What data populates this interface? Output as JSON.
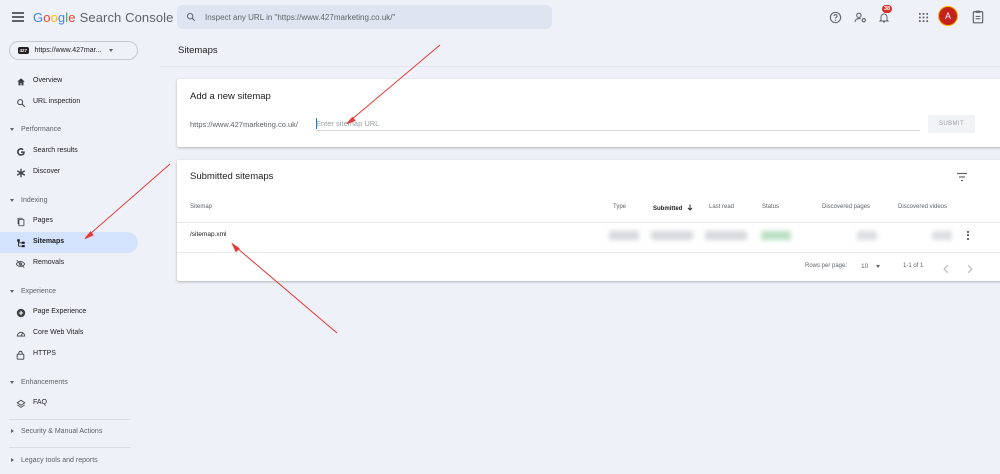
{
  "app": {
    "brand": {
      "g1": "G",
      "g2": "o",
      "g3": "o",
      "g4": "g",
      "g5": "l",
      "g6": "e",
      "product": "Search Console"
    },
    "search_placeholder": "Inspect any URL in \"https://www.427marketing.co.uk/\"",
    "notification_count": "38",
    "avatar_initial": "A"
  },
  "sidebar": {
    "property": {
      "badge": "427",
      "label": "https://www.427mar..."
    },
    "top_items": [
      {
        "label": "Overview",
        "icon": "home-icon"
      },
      {
        "label": "URL inspection",
        "icon": "search-icon"
      }
    ],
    "sections": [
      {
        "label": "Performance",
        "items": [
          {
            "label": "Search results",
            "icon": "google-g-icon"
          },
          {
            "label": "Discover",
            "icon": "asterisk-icon"
          }
        ]
      },
      {
        "label": "Indexing",
        "items": [
          {
            "label": "Pages",
            "icon": "pages-icon"
          },
          {
            "label": "Sitemaps",
            "icon": "sitemap-icon",
            "active": true
          },
          {
            "label": "Removals",
            "icon": "eye-off-icon"
          }
        ]
      },
      {
        "label": "Experience",
        "items": [
          {
            "label": "Page Experience",
            "icon": "plus-circle-icon"
          },
          {
            "label": "Core Web Vitals",
            "icon": "gauge-icon"
          },
          {
            "label": "HTTPS",
            "icon": "lock-icon"
          }
        ]
      },
      {
        "label": "Enhancements",
        "items": [
          {
            "label": "FAQ",
            "icon": "layers-icon"
          }
        ]
      }
    ],
    "collapsed": [
      "Security & Manual Actions",
      "Legacy tools and reports"
    ]
  },
  "main": {
    "page_title": "Sitemaps",
    "add_card": {
      "title": "Add a new sitemap",
      "prefix": "https://www.427marketing.co.uk/",
      "placeholder": "Enter sitemap URL",
      "submit_label": "SUBMIT"
    },
    "submitted_card": {
      "title": "Submitted sitemaps",
      "columns": [
        "Sitemap",
        "Type",
        "Submitted",
        "Last read",
        "Status",
        "Discovered pages",
        "Discovered videos"
      ],
      "sorted_column": "Submitted",
      "rows": [
        {
          "sitemap": "/sitemap.xml"
        }
      ],
      "footer": {
        "rows_per_page_label": "Rows per page:",
        "rows_per_page_value": "10",
        "range": "1-1 of 1"
      }
    }
  },
  "colors": {
    "accent": "#1a73e8",
    "active_nav": "#d3e3fd",
    "background": "#eef1f7",
    "annotation": "#e53935"
  }
}
